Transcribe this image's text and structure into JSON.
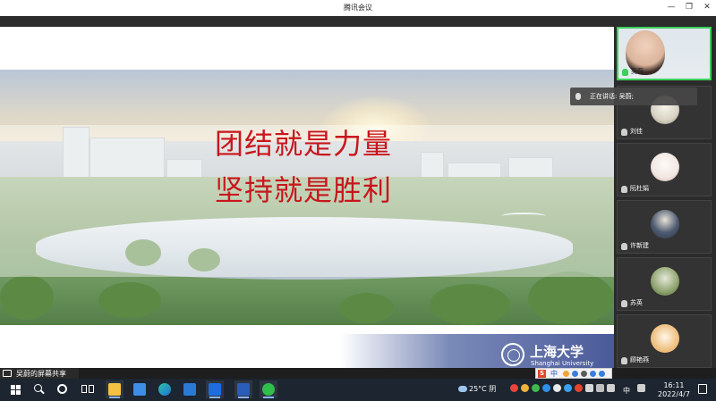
{
  "window": {
    "title": "腾讯会议",
    "controls": [
      "minimize",
      "restore",
      "close"
    ]
  },
  "slide": {
    "line1": "团结就是力量",
    "line2": "坚持就是胜利",
    "logo_cn": "上海大学",
    "logo_en": "Shanghai University",
    "text_color": "#c8161d"
  },
  "participants": [
    {
      "name": "吴蔚",
      "camera_on": true,
      "active": true
    },
    {
      "name": "刘佳",
      "camera_on": false
    },
    {
      "name": "阮杜娟",
      "camera_on": false
    },
    {
      "name": "许新建",
      "camera_on": false
    },
    {
      "name": "苏英",
      "camera_on": false
    },
    {
      "name": "顾艳燕",
      "camera_on": false
    }
  ],
  "speaking_tooltip": "正在讲话: 吴蔚;",
  "share_label": "吴蔚的屏幕共享",
  "accent_colors": {
    "active_border": "#3ccf5b",
    "taskbar": "#1c2530"
  },
  "ime": {
    "brand": "S",
    "mode": "中"
  },
  "taskbar": {
    "weather": "25°C 阴",
    "ime_lang": "中",
    "time": "16:11",
    "date": "2022/4/7",
    "apps": [
      "file-explorer",
      "microsoft-store",
      "edge",
      "mail",
      "tencent-meeting",
      "word",
      "wechat"
    ]
  }
}
